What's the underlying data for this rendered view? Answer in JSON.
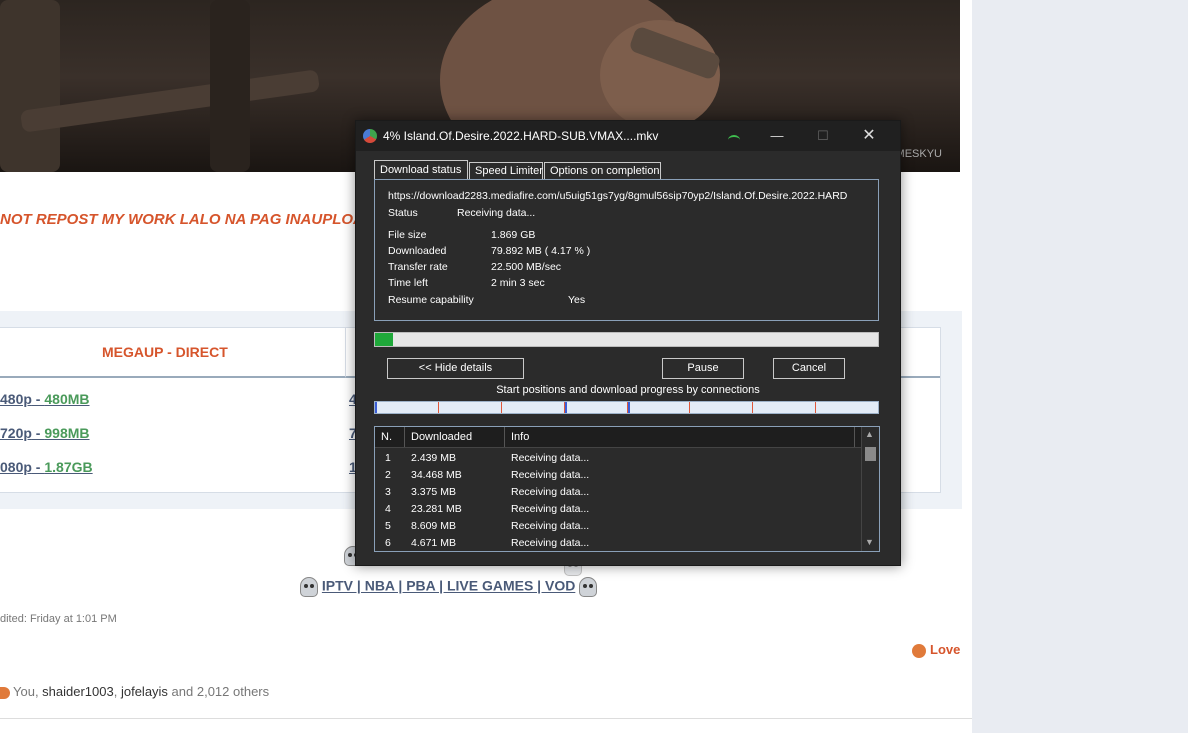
{
  "page": {
    "watermark": "MESKYU",
    "banner": "NOT REPOST MY WORK LALO NA PAG INAUPLOAD",
    "table_header": "MEGAUP - DIRECT",
    "links": [
      {
        "res": "480p",
        "sep": " - ",
        "size": "480MB"
      },
      {
        "res": "720p",
        "sep": " - ",
        "size": "998MB"
      },
      {
        "res": "080p",
        "sep": " - ",
        "size": "1.87GB"
      }
    ],
    "col2_fragments": [
      "4",
      "7",
      "1"
    ],
    "iptv": "IPTV | NBA | PBA | LIVE GAMES | VOD",
    "edited": "dited: Friday at 1:01 PM",
    "love": "Love",
    "reactions": {
      "you": "You, ",
      "u1": "shaider1003",
      "comma": ", ",
      "u2": "jofelayis",
      "rest": " and 2,012 others"
    }
  },
  "dialog": {
    "title": "4% Island.Of.Desire.2022.HARD-SUB.VMAX....mkv",
    "window_buttons": {
      "minimize": "—",
      "maximize": "☐",
      "close": "✕"
    },
    "tabs": [
      "Download status",
      "Speed Limiter",
      "Options on completion"
    ],
    "url": "https://download2283.mediafire.com/u5uig51gs7yg/8gmul56sip70yp2/Island.Of.Desire.2022.HARD",
    "status_label": "Status",
    "status_value": "Receiving data...",
    "file_size_label": "File size",
    "file_size_value": "1.869  GB",
    "downloaded_label": "Downloaded",
    "downloaded_value": "79.892  MB  ( 4.17 % )",
    "transfer_rate_label": "Transfer rate",
    "transfer_rate_value": "22.500  MB/sec",
    "time_left_label": "Time left",
    "time_left_value": "2 min 3 sec",
    "resume_label": "Resume capability",
    "resume_value": "Yes",
    "progress_percent": 4.17,
    "buttons": {
      "hide": "<< Hide details",
      "pause": "Pause",
      "cancel": "Cancel"
    },
    "connections_label": "Start positions and download progress by connections",
    "columns": [
      "N.",
      "Downloaded",
      "Info"
    ],
    "connections": [
      {
        "n": "1",
        "downloaded": "2.439  MB",
        "info": "Receiving data..."
      },
      {
        "n": "2",
        "downloaded": "34.468  MB",
        "info": "Receiving data..."
      },
      {
        "n": "3",
        "downloaded": "3.375  MB",
        "info": "Receiving data..."
      },
      {
        "n": "4",
        "downloaded": "23.281  MB",
        "info": "Receiving data..."
      },
      {
        "n": "5",
        "downloaded": "8.609  MB",
        "info": "Receiving data..."
      },
      {
        "n": "6",
        "downloaded": "4.671  MB",
        "info": "Receiving data..."
      }
    ],
    "colors": {
      "progress": "#1fa83a",
      "segment": "#e0583a",
      "accent": "#d6552c"
    }
  }
}
